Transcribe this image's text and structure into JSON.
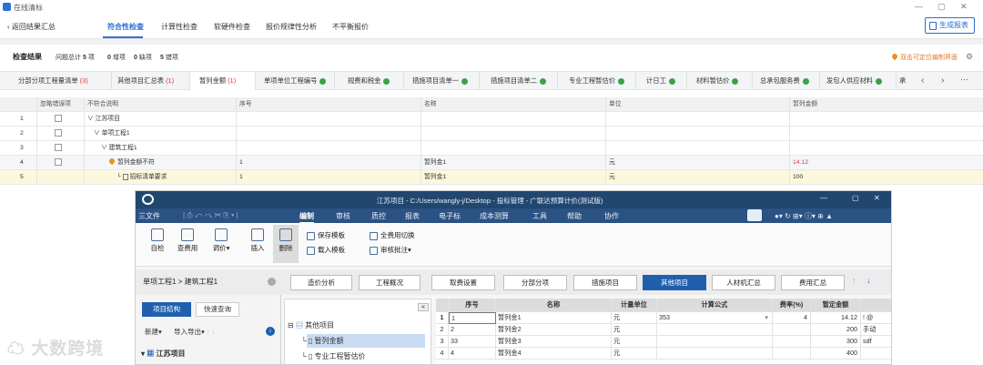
{
  "window": {
    "title": "在线清标",
    "controls": [
      "—",
      "▢",
      "✕"
    ]
  },
  "topnav": {
    "back": "返回结果汇总",
    "tabs": [
      "符合性检查",
      "计算性检查",
      "软硬件检查",
      "报价规律性分析",
      "不平衡报价"
    ],
    "generate": "生成报表"
  },
  "result": {
    "title": "检查结果",
    "issues_label": "问题总计",
    "issues": "5",
    "issues_unit": "项",
    "stats": [
      {
        "num": "0",
        "label": "增项"
      },
      {
        "num": "0",
        "label": "缺项"
      },
      {
        "num": "5",
        "label": "错项"
      }
    ],
    "locate": "双击可定位编制界面"
  },
  "sheet_tabs": [
    {
      "label": "分部分项工程量清单",
      "count": "(3)"
    },
    {
      "label": "其他项目汇总表",
      "count": "(1)"
    },
    {
      "label": "暂列金额",
      "count": "(1)"
    },
    {
      "label": "单项单位工程编号",
      "count": ""
    },
    {
      "label": "规费和税金",
      "count": ""
    },
    {
      "label": "措施项目清单一",
      "count": ""
    },
    {
      "label": "措施项目清单二",
      "count": ""
    },
    {
      "label": "专业工程暂估价",
      "count": ""
    },
    {
      "label": "计日工",
      "count": ""
    },
    {
      "label": "材料暂估价",
      "count": ""
    },
    {
      "label": "总承包服务费",
      "count": ""
    },
    {
      "label": "发包人供应材料",
      "count": ""
    },
    {
      "label": "承",
      "count": ""
    }
  ],
  "grid": {
    "headers": [
      "",
      "忽略错误项",
      "不符合说明",
      "序号",
      "名称",
      "单位",
      "暂列金额"
    ],
    "rows": [
      {
        "n": "1",
        "desc": "∨ 江苏项目",
        "seq": "",
        "name": "",
        "unit": "",
        "amt": ""
      },
      {
        "n": "2",
        "desc": "∨ 单项工程1",
        "seq": "",
        "name": "",
        "unit": "",
        "amt": ""
      },
      {
        "n": "3",
        "desc": "∨ 建筑工程1",
        "seq": "",
        "name": "",
        "unit": "",
        "amt": ""
      },
      {
        "n": "4",
        "desc": "暂列金额不符",
        "seq": "1",
        "name": "暂列金1",
        "unit": "元",
        "amt": "14.12"
      },
      {
        "n": "5",
        "desc": "招标清单要求",
        "seq": "1",
        "name": "暂列金1",
        "unit": "元",
        "amt": "100"
      }
    ]
  },
  "inset": {
    "title": "江苏项目 - C:/Users/wangly-j/Desktop - 投标管理 - 广联达预算计价(测试版)",
    "menu": [
      "三文件",
      "编制",
      "审核",
      "质控",
      "报表",
      "电子标",
      "成本测算",
      "工具",
      "帮助",
      "协作"
    ],
    "ribbon": {
      "check": "自检",
      "fee": "查费用",
      "adjust": "调价",
      "insert": "插入",
      "delete": "删除",
      "save_tpl": "保存模板",
      "load_tpl": "载入模板",
      "switch": "全费用切换",
      "review": "审核批注"
    },
    "breadcrumb": "单项工程1 > 建筑工程1",
    "nav_buttons": [
      "造价分析",
      "工程概况",
      "取费设置",
      "分部分项",
      "措施项目",
      "其他项目",
      "人材机汇总",
      "费用汇总"
    ],
    "left": {
      "tab1": "项目结构",
      "tab2": "快速查询",
      "new": "新建",
      "io": "导入导出",
      "project": "江苏项目"
    },
    "tree": [
      "其他项目",
      "暂列金额",
      "专业工程暂估价"
    ],
    "table": {
      "headers": [
        "",
        "序号",
        "名称",
        "计量单位",
        "计算公式",
        "费率(%)",
        "暂定金额"
      ],
      "rows": [
        [
          "1",
          "1",
          "暂列金1",
          "元",
          "353",
          "4",
          "14.12",
          "! @"
        ],
        [
          "2",
          "2",
          "暂列金2",
          "元",
          "",
          "",
          "200",
          "手动"
        ],
        [
          "3",
          "33",
          "暂列金3",
          "元",
          "",
          "",
          "300",
          "sdf"
        ],
        [
          "4",
          "4",
          "暂列金4",
          "元",
          "",
          "",
          "400",
          ""
        ]
      ]
    }
  },
  "watermark": "大数跨境"
}
